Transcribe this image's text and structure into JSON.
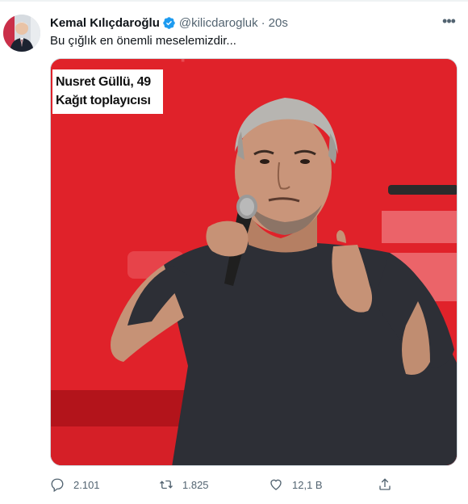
{
  "tweet": {
    "author_name": "Kemal Kılıçdaroğlu",
    "handle": "@kilicdarogluk",
    "separator": "·",
    "time": "20s",
    "text": "Bu çığlık en önemli meselemizdir...",
    "more_label": "•••"
  },
  "media": {
    "caption_line1": "Nusret Güllü, 49",
    "caption_line2": "Kağıt toplayıcısı"
  },
  "actions": {
    "replies": "2.101",
    "retweets": "1.825",
    "likes": "12,1 B"
  },
  "colors": {
    "verified": "#1d9bf0",
    "text_primary": "#0f1419",
    "text_secondary": "#536471",
    "background_red": "#e0222a"
  },
  "icons": [
    "verified-badge-icon",
    "more-icon",
    "reply-icon",
    "retweet-icon",
    "like-icon",
    "share-icon"
  ]
}
